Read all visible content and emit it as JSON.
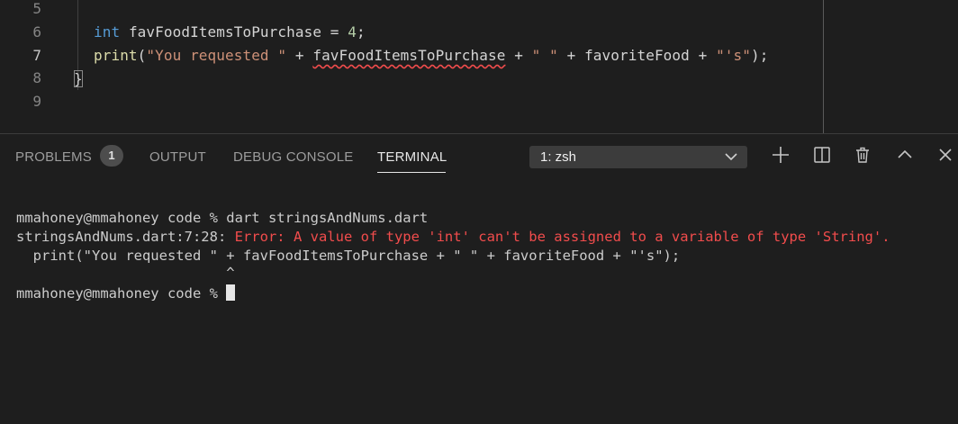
{
  "editor": {
    "line_numbers": [
      "5",
      "6",
      "7",
      "8",
      "9"
    ],
    "line6": {
      "kw": "int",
      "var": "favFoodItemsToPurchase",
      "op": " = ",
      "num": "4",
      "end": ";"
    },
    "line7": {
      "fn": "print",
      "open": "(",
      "str1": "\"You requested \"",
      "plus1": " + ",
      "var1": "favFoodItemsToPurchase",
      "plus2": " + ",
      "str2": "\" \"",
      "plus3": " + ",
      "var2": "favoriteFood",
      "plus4": " + ",
      "str3": "\"'s\"",
      "close": ");"
    },
    "line8": "}"
  },
  "panel": {
    "tabs": {
      "problems": "PROBLEMS",
      "problems_count": "1",
      "output": "OUTPUT",
      "debug_console": "DEBUG CONSOLE",
      "terminal": "TERMINAL"
    },
    "terminal_select": "1: zsh"
  },
  "terminal": {
    "line1": "mmahoney@mmahoney code % dart stringsAndNums.dart",
    "line2_prefix": "stringsAndNums.dart:7:28: ",
    "line2_error": "Error: A value of type 'int' can't be assigned to a variable of type 'String'.",
    "line3": "  print(\"You requested \" + favFoodItemsToPurchase + \" \" + favoriteFood + \"'s\");",
    "line4": "                         ^",
    "line5": "mmahoney@mmahoney code % "
  },
  "colors": {
    "keyword": "#569cd6",
    "function": "#dcdcaa",
    "string": "#ce9178",
    "number": "#b5cea8",
    "error": "#f14c4c"
  },
  "icons": [
    "plus-icon",
    "split-terminal-icon",
    "trash-icon",
    "chevron-up-icon",
    "close-icon",
    "chevron-down-icon"
  ]
}
